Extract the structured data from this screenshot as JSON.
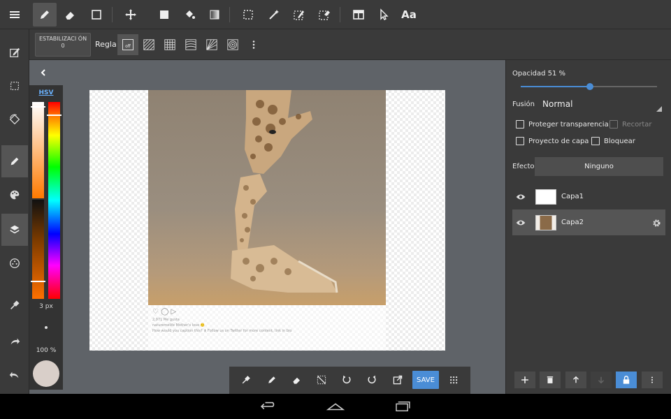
{
  "top_toolbar": {
    "tools": [
      "pen-tool",
      "eraser-tool",
      "shape-tool",
      "move-tool",
      "fill-rect-tool",
      "bucket-tool",
      "gradient-tool",
      "select-rect-tool",
      "magic-wand-tool",
      "select-pen-tool",
      "select-eraser-tool",
      "panel-tool",
      "pointer-tool"
    ],
    "text_tool_label": "Aa"
  },
  "sub_toolbar": {
    "stabilizer_label": "ESTABILIZACI ÓN",
    "stabilizer_value": "0",
    "ruler_label": "Regla",
    "ruler_off_label": "off"
  },
  "color_panel": {
    "mode_label": "HSV",
    "brush_size": "3 px",
    "brush_opacity": "100 %",
    "current_color": "#d9cfc9"
  },
  "canvas": {
    "likes_text": "2,971 Me gusta",
    "caption_1": "naturemelife Mother's love 🙂",
    "caption_2": "How would you caption this? ⬇ Follow us on Twitter for more content, link in bio"
  },
  "bottom_toolbar": {
    "save_label": "SAVE"
  },
  "layer_panel": {
    "opacity_label": "Opacidad 51 %",
    "opacity_value": 0.51,
    "blend_label": "Fusión",
    "blend_value": "Normal",
    "protect_transparency": "Proteger transparencia",
    "clip_label": "Recortar",
    "layer_project": "Proyecto de capa",
    "lock_label": "Bloquear",
    "effect_label": "Efecto",
    "effect_value": "Ninguno",
    "layers": [
      {
        "name": "Capa1",
        "selected": false
      },
      {
        "name": "Capa2",
        "selected": true
      }
    ],
    "accent_color": "#4a8dd6"
  }
}
